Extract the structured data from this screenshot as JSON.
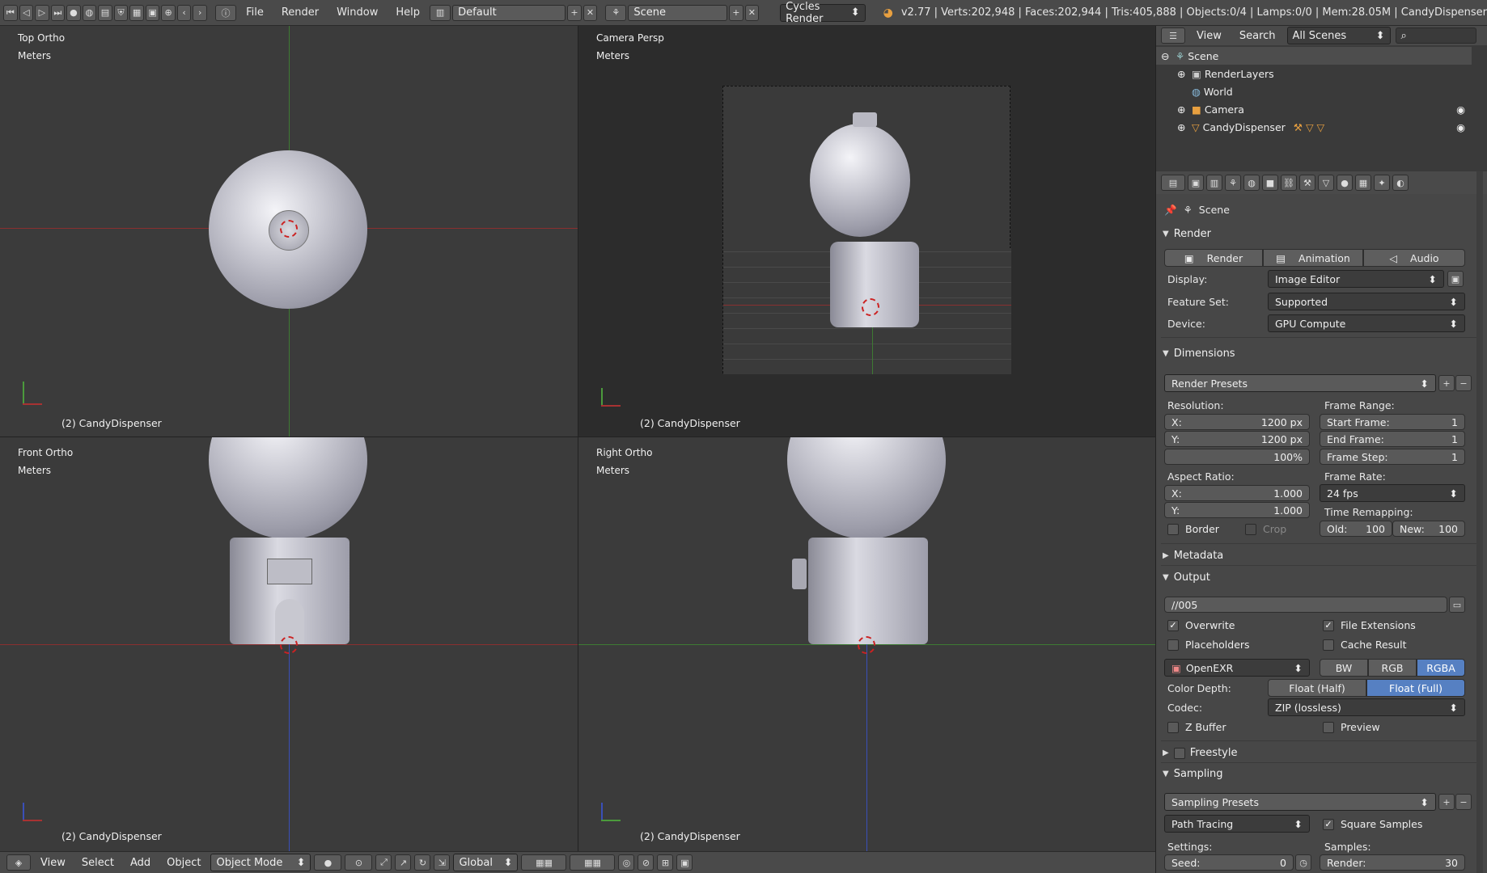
{
  "topbar": {
    "menus": [
      "File",
      "Render",
      "Window",
      "Help"
    ],
    "layout": "Default",
    "scene": "Scene",
    "engine": "Cycles Render",
    "stats": "v2.77 | Verts:202,948 | Faces:202,944 | Tris:405,888 | Objects:0/4 | Lamps:0/0 | Mem:28.05M | CandyDispenser"
  },
  "viewports": {
    "top_left": {
      "view": "Top Ortho",
      "units": "Meters",
      "object": "(2) CandyDispenser"
    },
    "top_right": {
      "view": "Camera Persp",
      "units": "Meters",
      "object": "(2) CandyDispenser"
    },
    "bottom_left": {
      "view": "Front Ortho",
      "units": "Meters",
      "object": "(2) CandyDispenser"
    },
    "bottom_right": {
      "view": "Right Ortho",
      "units": "Meters",
      "object": "(2) CandyDispenser"
    }
  },
  "bottombar": {
    "menus": [
      "View",
      "Select",
      "Add",
      "Object"
    ],
    "mode": "Object Mode",
    "orientation": "Global"
  },
  "outliner": {
    "menus": [
      "View",
      "Search"
    ],
    "scenes_select": "All Scenes",
    "items": [
      "Scene",
      "RenderLayers",
      "World",
      "Camera",
      "CandyDispenser"
    ]
  },
  "props": {
    "context": "Scene",
    "render": {
      "title": "Render",
      "buttons": [
        "Render",
        "Animation",
        "Audio"
      ],
      "display_label": "Display:",
      "display": "Image Editor",
      "feature_label": "Feature Set:",
      "feature": "Supported",
      "device_label": "Device:",
      "device": "GPU Compute"
    },
    "dimensions": {
      "title": "Dimensions",
      "presets": "Render Presets",
      "resolution_label": "Resolution:",
      "res_x_label": "X:",
      "res_x": "1200 px",
      "res_y_label": "Y:",
      "res_y": "1200 px",
      "res_pct": "100%",
      "frame_range_label": "Frame Range:",
      "start_label": "Start Frame:",
      "start": "1",
      "end_label": "End Frame:",
      "end": "1",
      "step_label": "Frame Step:",
      "step": "1",
      "aspect_label": "Aspect Ratio:",
      "asp_x_label": "X:",
      "asp_x": "1.000",
      "asp_y_label": "Y:",
      "asp_y": "1.000",
      "frame_rate_label": "Frame Rate:",
      "frame_rate": "24 fps",
      "time_remap_label": "Time Remapping:",
      "old_label": "Old:",
      "old": "100",
      "new_label": "New:",
      "new": "100",
      "border": "Border",
      "crop": "Crop"
    },
    "metadata": {
      "title": "Metadata"
    },
    "output": {
      "title": "Output",
      "path": "//005",
      "overwrite": "Overwrite",
      "file_ext": "File Extensions",
      "placeholders": "Placeholders",
      "cache": "Cache Result",
      "format": "OpenEXR",
      "color_modes": [
        "BW",
        "RGB",
        "RGBA"
      ],
      "color_depth_label": "Color Depth:",
      "depths": [
        "Float (Half)",
        "Float (Full)"
      ],
      "codec_label": "Codec:",
      "codec": "ZIP (lossless)",
      "zbuffer": "Z Buffer",
      "preview": "Preview"
    },
    "freestyle": {
      "title": "Freestyle"
    },
    "sampling": {
      "title": "Sampling",
      "presets": "Sampling Presets",
      "integrator": "Path Tracing",
      "square": "Square Samples",
      "settings_label": "Settings:",
      "samples_label": "Samples:",
      "seed_label": "Seed:",
      "seed": "0",
      "render_label": "Render:",
      "render": "30"
    }
  },
  "colors": {
    "accent": "#5680c2",
    "x_axis": "#a83232",
    "y_axis": "#4b9a3c",
    "z_axis": "#3a4fb8"
  }
}
